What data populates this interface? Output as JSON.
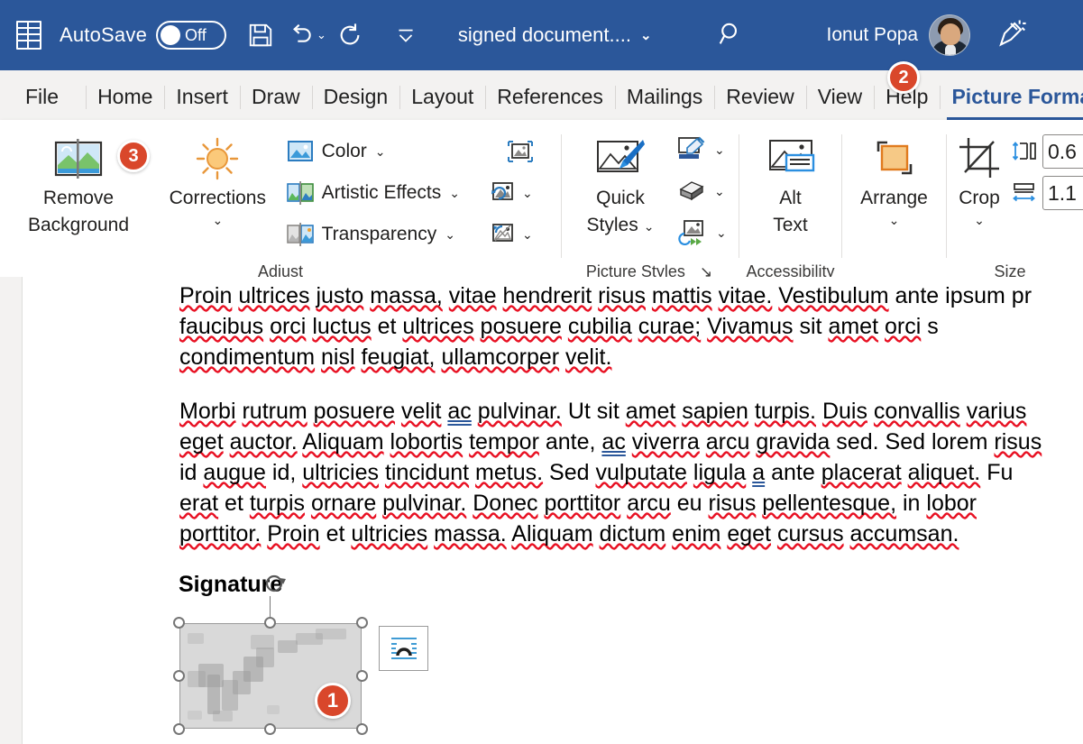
{
  "titlebar": {
    "app_logo": "word-logo",
    "autosave_label": "AutoSave",
    "autosave_state": "Off",
    "quick_access": [
      {
        "name": "save-button",
        "icon": "save-icon"
      },
      {
        "name": "undo-button",
        "icon": "undo-icon"
      },
      {
        "name": "redo-button",
        "icon": "redo-icon"
      },
      {
        "name": "customize-quick-access-button",
        "icon": "chevron-down-icon"
      }
    ],
    "document_title": "signed document....",
    "title_chevron": "⌄",
    "search_icon": "search-icon",
    "user_name": "Ionut Popa",
    "avatar": "user-avatar",
    "pen_icon": "pen-highlighter-icon"
  },
  "tabs": [
    {
      "label": "File",
      "active": false
    },
    {
      "label": "Home",
      "active": false
    },
    {
      "label": "Insert",
      "active": false
    },
    {
      "label": "Draw",
      "active": false
    },
    {
      "label": "Design",
      "active": false
    },
    {
      "label": "Layout",
      "active": false
    },
    {
      "label": "References",
      "active": false
    },
    {
      "label": "Mailings",
      "active": false
    },
    {
      "label": "Review",
      "active": false
    },
    {
      "label": "View",
      "active": false
    },
    {
      "label": "Help",
      "active": false
    },
    {
      "label": "Picture Format",
      "active": true
    }
  ],
  "ribbon": {
    "groups": [
      {
        "label": "Adjust",
        "remove_background_line1": "Remove",
        "remove_background_line2": "Background",
        "corrections_label": "Corrections",
        "color_label": "Color",
        "artistic_effects_label": "Artistic Effects",
        "transparency_label": "Transparency"
      },
      {
        "label": "Picture Styles",
        "quick_styles_line1": "Quick",
        "quick_styles_line2": "Styles",
        "dialog_launcher": "↘"
      },
      {
        "label": "Accessibility",
        "alt_text_line1": "Alt",
        "alt_text_line2": "Text"
      },
      {
        "label": "",
        "arrange_label": "Arrange"
      },
      {
        "label": "Size",
        "crop_label": "Crop",
        "height_value": "0.6",
        "width_value": "1.1"
      }
    ],
    "chevron": "⌄"
  },
  "badges": [
    {
      "id": "badge-3",
      "number": "3",
      "target": "remove-background-button"
    },
    {
      "id": "badge-2",
      "number": "2",
      "target": "tab-picture-format"
    },
    {
      "id": "badge-1",
      "number": "1",
      "target": "selected-signature-image"
    }
  ],
  "document": {
    "paragraph1": {
      "line1": "Proin ultrices justo massa, vitae hendrerit risus mattis vitae. Vestibulum ante ipsum pr",
      "line2": "faucibus orci luctus et ultrices posuere cubilia curae; Vivamus sit amet orci s",
      "line3": "condimentum nisl feugiat, ullamcorper velit."
    },
    "paragraph2": {
      "line1": "Morbi rutrum posuere velit ac pulvinar. Ut sit amet sapien turpis. Duis convallis varius",
      "line2": "eget auctor. Aliquam lobortis tempor ante, ac viverra arcu gravida sed. Sed lorem risus",
      "line3": "id augue id, ultricies tincidunt metus. Sed vulputate ligula a ante placerat aliquet. Fu",
      "line4": "erat et turpis ornare pulvinar. Donec porttitor arcu eu risus pellentesque, in lobor",
      "line5": "porttitor. Proin et ultricies massa. Aliquam dictum enim eget cursus accumsan."
    },
    "signature_heading": "Signature",
    "selected_image_name": "signature-image",
    "layout_options_icon": "text-wrapping-icon"
  },
  "colors": {
    "titlebar_blue": "#2b579a",
    "accent_blue": "#2b579a",
    "badge_orange": "#d9472b",
    "ribbon_bg": "#ffffff",
    "tabbar_bg": "#f3f2f1",
    "spelling_red": "#e81123"
  }
}
